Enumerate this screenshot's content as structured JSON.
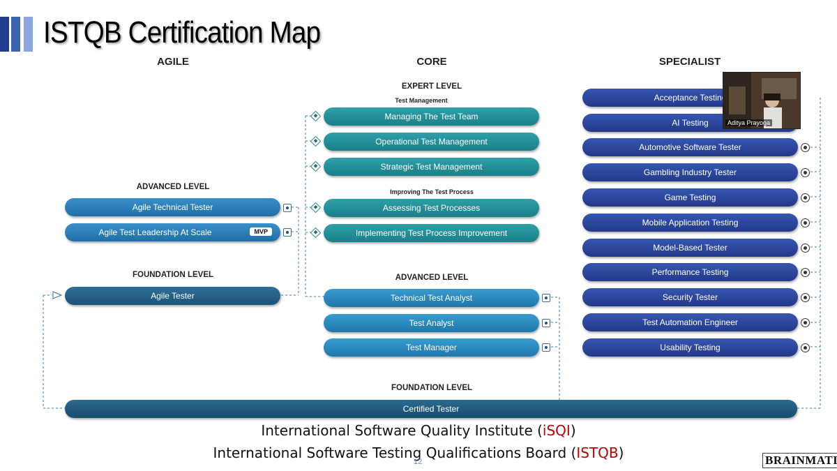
{
  "slide": {
    "title": "ISTQB Certification Map",
    "page_number": "12",
    "accent_colors": [
      "#1d3f8c",
      "#3d62b0",
      "#8aa6dc"
    ]
  },
  "columns": {
    "agile": "AGILE",
    "core": "CORE",
    "specialist": "SPECIALIST"
  },
  "core": {
    "expert_level": "EXPERT LEVEL",
    "test_management": "Test Management",
    "managing_team": "Managing The Test Team",
    "operational": "Operational Test Management",
    "strategic": "Strategic Test Management",
    "improving": "Improving The Test Process",
    "assessing": "Assessing Test Processes",
    "implementing": "Implementing Test Process Improvement",
    "advanced_level": "ADVANCED LEVEL",
    "tta": "Technical Test Analyst",
    "ta": "Test Analyst",
    "tm": "Test Manager",
    "foundation_level": "FOUNDATION LEVEL",
    "certified_tester": "Certified Tester"
  },
  "agile": {
    "advanced_level": "ADVANCED LEVEL",
    "technical_tester": "Agile Technical Tester",
    "leadership": "Agile Test Leadership At Scale",
    "mvp_badge": "MVP",
    "foundation_level": "FOUNDATION LEVEL",
    "agile_tester": "Agile Tester"
  },
  "specialist": {
    "items": [
      "Acceptance Testing",
      "AI Testing",
      "Automotive Software Tester",
      "Gambling Industry Tester",
      "Game Testing",
      "Mobile Application Testing",
      "Model-Based Tester",
      "Performance Testing",
      "Security Tester",
      "Test Automation Engineer",
      "Usability Testing"
    ]
  },
  "footer": {
    "line1_before": "International Software Quality Institute (",
    "line1_abbr": "iSQI",
    "line1_after": ")",
    "line2_before": "International Software Testing Qualifications Board (",
    "line2_abbr": "ISTQB",
    "line2_after": ")",
    "abbr_color": "#c00000"
  },
  "video": {
    "participant_name": "Aditya Prayoga"
  },
  "logo": {
    "text": "BRAINMATICS"
  }
}
